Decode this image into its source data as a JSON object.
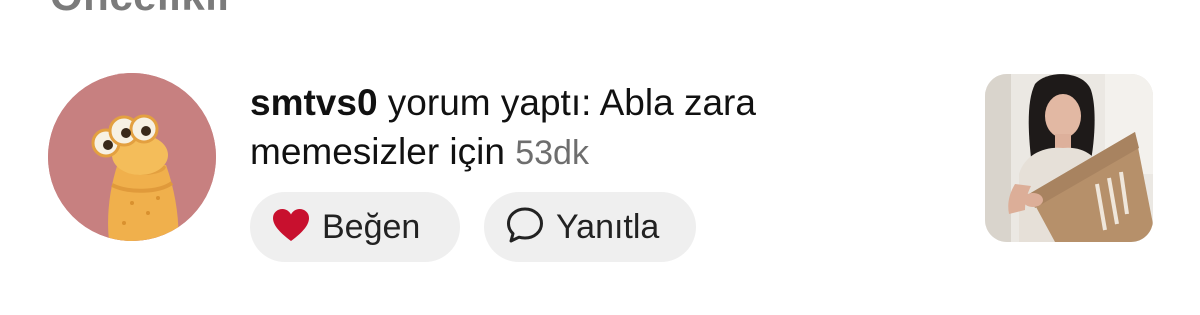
{
  "section": {
    "header": "Öncelikli"
  },
  "notification": {
    "username": "smtvs0",
    "action_text": " yorum yaptı: Abla zara memesizler için ",
    "time": "53dk"
  },
  "actions": {
    "like_label": "Beğen",
    "reply_label": "Yanıtla"
  },
  "icons": {
    "like": "heart-icon",
    "reply": "speech-bubble-icon"
  },
  "colors": {
    "heart": "#c8102e",
    "avatar_bg": "#c78080",
    "pill_bg": "#efefef",
    "time_text": "#6e6e6e"
  }
}
